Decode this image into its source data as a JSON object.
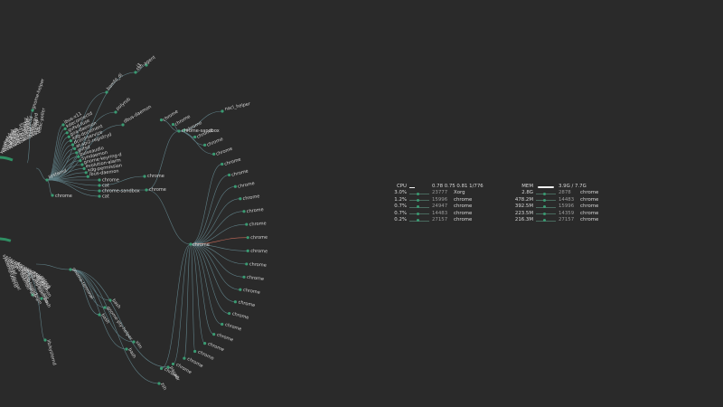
{
  "colors": {
    "background": "#2a2a2a",
    "node": "#3a9b72",
    "edge": "#5f7f86",
    "highlight_edge": "#c86b5a",
    "ring": "#2f8f63"
  },
  "cpu": {
    "label": "CPU",
    "load": "0.78 0.75 0.81 1/776",
    "rows": [
      {
        "value": "3.0%",
        "pid": "23777",
        "name": "Xorg"
      },
      {
        "value": "1.2%",
        "pid": "15996",
        "name": "chrome"
      },
      {
        "value": "0.7%",
        "pid": "24947",
        "name": "chrome"
      },
      {
        "value": "0.7%",
        "pid": "14483",
        "name": "chrome"
      },
      {
        "value": "0.2%",
        "pid": "27157",
        "name": "chrome"
      }
    ]
  },
  "mem": {
    "label": "MEM",
    "usage": "3.9G / 7.7G",
    "used_fraction": 0.51,
    "rows": [
      {
        "value": "2.8G",
        "pid": "2878",
        "name": "chrome"
      },
      {
        "value": "478.2M",
        "pid": "14483",
        "name": "chrome"
      },
      {
        "value": "392.5M",
        "pid": "15996",
        "name": "chrome"
      },
      {
        "value": "223.5M",
        "pid": "14359",
        "name": "chrome"
      },
      {
        "value": "216.3M",
        "pid": "27157",
        "name": "chrome"
      }
    ]
  },
  "tree": {
    "upper_branch": [
      "ssh-agent",
      "i3",
      "bamfd_dj",
      "polyrob",
      "dbus-daemon",
      "ibus-x11",
      "kdeconnectd",
      "gvfsd-fuse",
      "goa-daemon",
      "xdg-document",
      "dconf-service",
      "at-spi2-registryd",
      "gvfsd",
      "pulseaudio",
      "syndaemon",
      "gnome-keyring-d",
      "evolution-alarm",
      "xdg-permission",
      "ibus-daemon"
    ],
    "systemd_children": [
      "chrome",
      "cat",
      "chrome-sandbox",
      "cat"
    ],
    "chrome_sandbox_children": [
      "chrome",
      "chrome"
    ],
    "zygote_children": [
      "nacl_helper",
      "chrome-sandbox"
    ],
    "chrome_tabs": [
      "chrome",
      "chrome",
      "chrome",
      "chrome",
      "chrome",
      "chrome",
      "chrome",
      "chrome",
      "chrome",
      "chrome",
      "chrome",
      "chrome",
      "chrome",
      "chrome",
      "chrome",
      "chrome",
      "chrome",
      "chrome",
      "chrome",
      "chrome",
      "chrome",
      "chrome",
      "chrome",
      "chrome",
      "chrome",
      "chrome"
    ],
    "terminal_children": [
      "bash",
      "gnome-pty-helper",
      "bash",
      "vim",
      "bash",
      "pacaur",
      "zsh"
    ],
    "left_labels": [
      "kworker",
      "ksoftirqd",
      "rcu_sched",
      "migration",
      "watchdog",
      "kthreadd",
      "cpuhp",
      "kdevtmpfs",
      "netns",
      "khungtaskd",
      "oom_reaper",
      "writeback",
      "kcompactd",
      "ksmd",
      "crypto",
      "kintegrityd",
      "kblockd",
      "ata_sff",
      "md",
      "edac-poller"
    ],
    "lower_left_labels": [
      "systemd-udevd",
      "systemd-journal",
      "lvmetad",
      "sshd",
      "cron",
      "dbus-daemon",
      "NetworkManager",
      "systemd-logind",
      "polkitd",
      "gdm",
      "accounts-daemon",
      "wpa_supplicant",
      "dhclient",
      "rtkit-daemon",
      "upowerd",
      "udisksd",
      "colord"
    ],
    "misc": {
      "gnome_helper": "gnome-helper",
      "systemd": "systemd",
      "chrome_root": "chrome",
      "zygote_label": "chrome",
      "terminal": "gnome-terminal",
      "lib_label": "lib/systemd",
      "xfce4": "xfce4-notifyd",
      "gnome_shell": "gnome-shell",
      "sshd_child": "login",
      "bash_child": "bash"
    }
  }
}
